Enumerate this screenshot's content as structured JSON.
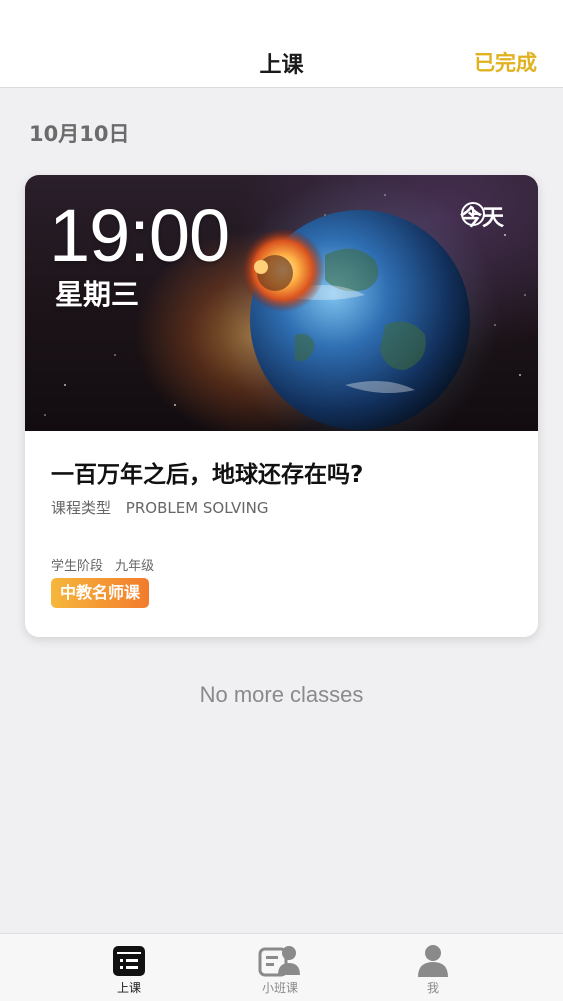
{
  "header": {
    "title": "上课",
    "action_label": "已完成",
    "action_color": "#e0b21f"
  },
  "date_label": "10月10日",
  "class_card": {
    "time": "19:00",
    "weekday": "星期三",
    "day_badge": "今天",
    "clock_icon": "clock-icon",
    "title": "一百万年之后，地球还存在吗?",
    "course_type_label": "课程类型",
    "course_type_value": "PROBLEM SOLVING",
    "stage_label": "学生阶段",
    "stage_value": "九年级",
    "tag_label": "中教名师课",
    "tag_colors": [
      "#f6b73c",
      "#f27b2c"
    ]
  },
  "empty_message": "No more classes",
  "tabbar": {
    "items": [
      {
        "label": "上课",
        "icon": "class-schedule-icon",
        "active": true
      },
      {
        "label": "小班课",
        "icon": "small-class-icon",
        "active": false
      },
      {
        "label": "我",
        "icon": "profile-icon",
        "active": false
      }
    ]
  }
}
